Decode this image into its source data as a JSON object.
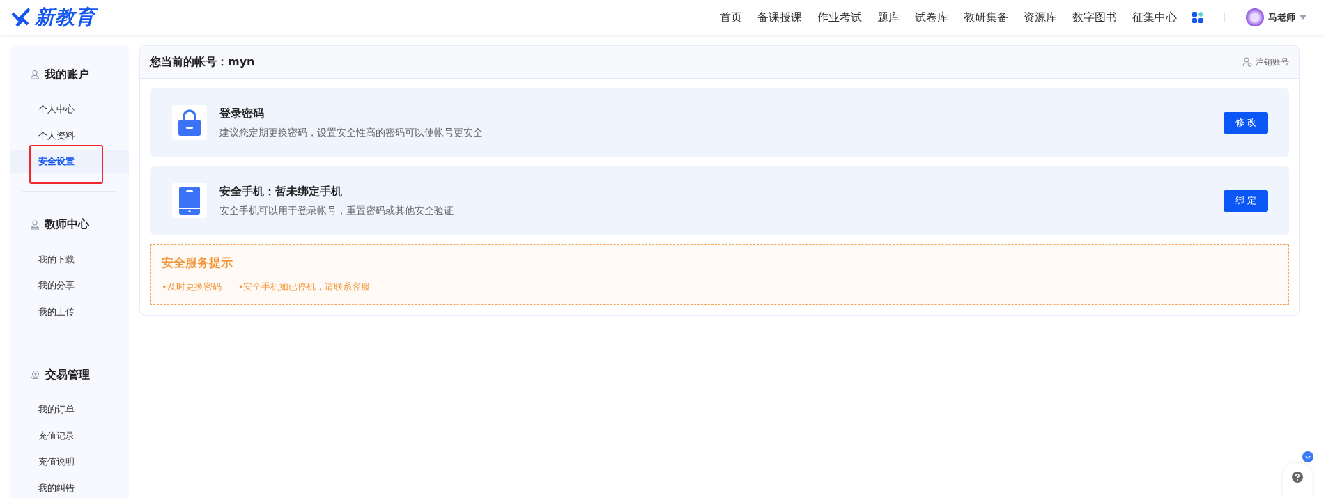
{
  "header": {
    "logo": "新教育",
    "nav": [
      {
        "label": "首页"
      },
      {
        "label": "备课授课"
      },
      {
        "label": "作业考试"
      },
      {
        "label": "题库"
      },
      {
        "label": "试卷库"
      },
      {
        "label": "教研集备"
      },
      {
        "label": "资源库"
      },
      {
        "label": "数字图书"
      },
      {
        "label": "征集中心"
      }
    ],
    "user": "马老师"
  },
  "sidebar": {
    "groups": [
      {
        "title": "我的账户",
        "kind": "user",
        "items": [
          {
            "label": "个人中心",
            "selected": false,
            "outlined": false
          },
          {
            "label": "个人资料",
            "selected": false,
            "outlined": false
          },
          {
            "label": "安全设置",
            "selected": true,
            "outlined": true
          }
        ]
      },
      {
        "title": "教师中心",
        "kind": "teacher",
        "items": [
          {
            "label": "我的下载",
            "selected": false,
            "outlined": false
          },
          {
            "label": "我的分享",
            "selected": false,
            "outlined": false
          },
          {
            "label": "我的上传",
            "selected": false,
            "outlined": false
          }
        ]
      },
      {
        "title": "交易管理",
        "kind": "money",
        "items": [
          {
            "label": "我的订单",
            "selected": false,
            "outlined": false
          },
          {
            "label": "充值记录",
            "selected": false,
            "outlined": false
          },
          {
            "label": "充值说明",
            "selected": false,
            "outlined": false
          },
          {
            "label": "我的纠错",
            "selected": false,
            "outlined": false
          }
        ]
      }
    ]
  },
  "account": {
    "title": "您当前的帐号：myn",
    "cancel": "注销账号"
  },
  "security_items": [
    {
      "kind": "password",
      "title": "登录密码",
      "description": "建议您定期更换密码，设置安全性高的密码可以使帐号更安全",
      "button": "修 改"
    },
    {
      "kind": "phone",
      "title": "安全手机：暂未绑定手机",
      "description": "安全手机可以用于登录帐号，重置密码或其他安全验证",
      "button": "绑 定"
    }
  ],
  "tips": {
    "title": "安全服务提示",
    "items": [
      "•及时更换密码",
      "•安全手机如已停机，请联系客服"
    ]
  }
}
